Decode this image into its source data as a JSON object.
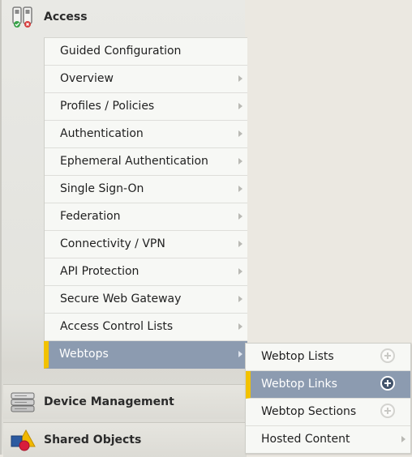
{
  "colors": {
    "active_bg": "#8c9bb0",
    "active_marker": "#f2c200",
    "menu_bg": "#f7f8f5"
  },
  "sections": {
    "access": {
      "label": "Access",
      "icon": "access-icon"
    },
    "device_management": {
      "label": "Device Management",
      "icon": "server-icon"
    },
    "shared_objects": {
      "label": "Shared Objects",
      "icon": "shapes-icon"
    }
  },
  "access_menu": {
    "items": [
      {
        "label": "Guided Configuration",
        "has_submenu": false
      },
      {
        "label": "Overview",
        "has_submenu": true
      },
      {
        "label": "Profiles / Policies",
        "has_submenu": true
      },
      {
        "label": "Authentication",
        "has_submenu": true
      },
      {
        "label": "Ephemeral Authentication",
        "has_submenu": true
      },
      {
        "label": "Single Sign-On",
        "has_submenu": true
      },
      {
        "label": "Federation",
        "has_submenu": true
      },
      {
        "label": "Connectivity / VPN",
        "has_submenu": true
      },
      {
        "label": "API Protection",
        "has_submenu": true
      },
      {
        "label": "Secure Web Gateway",
        "has_submenu": true
      },
      {
        "label": "Access Control Lists",
        "has_submenu": true
      },
      {
        "label": "Webtops",
        "has_submenu": true,
        "active": true
      }
    ]
  },
  "webtops_menu": {
    "items": [
      {
        "label": "Webtop Lists",
        "action": "add-icon"
      },
      {
        "label": "Webtop Links",
        "action": "add-icon",
        "active": true
      },
      {
        "label": "Webtop Sections",
        "action": "add-icon"
      },
      {
        "label": "Hosted Content",
        "action": "chevron-right-icon"
      }
    ]
  }
}
